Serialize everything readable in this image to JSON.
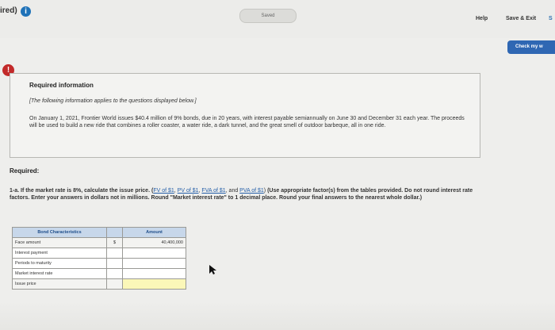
{
  "header": {
    "left_label": "ired)",
    "info_icon": "i",
    "saved_label": "Saved",
    "help_label": "Help",
    "save_exit_label": "Save & Exit",
    "edge_label": "S",
    "check_label": "Check my w"
  },
  "info": {
    "alert_icon": "!",
    "title": "Required information",
    "note": "[The following information applies to the questions displayed below.]",
    "paragraph": "On January 1, 2021, Frontier World issues $40.4 million of 9% bonds, due in 20 years, with interest payable semiannually on June 30 and December 31 each year. The proceeds will be used to build a new ride that combines a roller coaster, a water ride, a dark tunnel, and the great smell of outdoor barbeque, all in one ride."
  },
  "required": {
    "label": "Required:",
    "q_prefix": "1-a. If the market rate is 8%, calculate the issue price. (",
    "links": [
      "FV of $1",
      "PV of $1",
      "FVA of $1",
      "PVA of $1"
    ],
    "sep1": ", ",
    "sep2": ", ",
    "sep3": ", and ",
    "q_close": ")",
    "bold_text": " (Use appropriate factor(s) from the tables provided. Do not round interest rate factors. Enter your answers in dollars not in millions. Round \"Market interest rate\" to 1 decimal place. Round your final answers to the nearest whole dollar.)"
  },
  "table": {
    "header_left": "Bond Characteristics",
    "header_right": "Amount",
    "rows": [
      {
        "label": "Face amount",
        "currency": "$",
        "value": "40,400,000"
      },
      {
        "label": "Interest payment",
        "currency": "",
        "value": ""
      },
      {
        "label": "Periods to maturity",
        "currency": "",
        "value": ""
      },
      {
        "label": "Market interest rate",
        "currency": "",
        "value": ""
      },
      {
        "label": "Issue price",
        "currency": "",
        "value": ""
      }
    ]
  },
  "colors": {
    "accent": "#2f67b3",
    "alert": "#c22a2a",
    "table_header": "#c7d7ea",
    "highlight": "#fbf7b8"
  }
}
